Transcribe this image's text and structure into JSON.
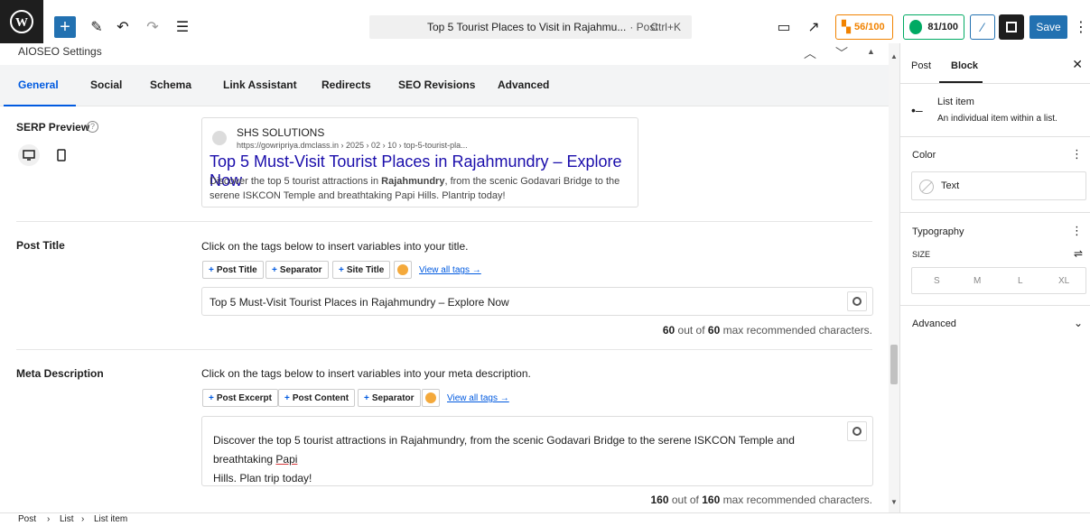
{
  "toolbar": {
    "doc_title": "Top 5 Tourist Places to Visit in Rajahmu...",
    "doc_type": "· Post",
    "shortcut": "Ctrl+K",
    "seo_score_orange": "56/100",
    "seo_score_green": "81/100",
    "save_label": "Save"
  },
  "panel": {
    "title": "AIOSEO Settings",
    "tabs": [
      "General",
      "Social",
      "Schema",
      "Link Assistant",
      "Redirects",
      "SEO Revisions",
      "Advanced"
    ],
    "serp": {
      "label": "SERP Preview",
      "site_name": "SHS SOLUTIONS",
      "url": "https://gowripriya.dmclass.in › 2025 › 02 › 10 › top-5-tourist-pla...",
      "title": "Top 5 Must-Visit Tourist Places in Rajahmundry – Explore Now",
      "desc_pre": "Discover the top 5 tourist attractions in ",
      "desc_bold": "Rajahmundry",
      "desc_post": ", from the scenic Godavari Bridge to the serene ISKCON Temple and breathtaking Papi Hills. Plantrip today!"
    },
    "post_title": {
      "label": "Post Title",
      "hint": "Click on the tags below to insert variables into your title.",
      "tags": [
        "Post Title",
        "Separator",
        "Site Title"
      ],
      "view_all": "View all tags →",
      "value": "Top 5 Must-Visit Tourist Places in Rajahmundry – Explore Now",
      "count": "60",
      "max": "60",
      "count_suffix": "max recommended characters.",
      "out_of": "out of"
    },
    "meta_desc": {
      "label": "Meta Description",
      "hint": "Click on the tags below to insert variables into your meta description.",
      "tags": [
        "Post Excerpt",
        "Post Content",
        "Separator"
      ],
      "view_all": "View all tags →",
      "value_line1": "Discover the top 5 tourist attractions in Rajahmundry, from the scenic Godavari Bridge to the serene ISKCON Temple and breathtaking",
      "value_papi": "Papi",
      "value_line2": "Hills. Plan trip today!",
      "count": "160",
      "max": "160",
      "count_suffix": "max recommended characters.",
      "out_of": "out of"
    }
  },
  "sidebar": {
    "tabs": [
      "Post",
      "Block"
    ],
    "block_name": "List item",
    "block_desc": "An individual item within a list.",
    "color_label": "Color",
    "color_text": "Text",
    "typography_label": "Typography",
    "size_label": "SIZE",
    "sizes": [
      "S",
      "M",
      "L",
      "XL"
    ],
    "advanced_label": "Advanced"
  },
  "footer": {
    "breadcrumbs": [
      "Post",
      "List",
      "List item"
    ]
  }
}
